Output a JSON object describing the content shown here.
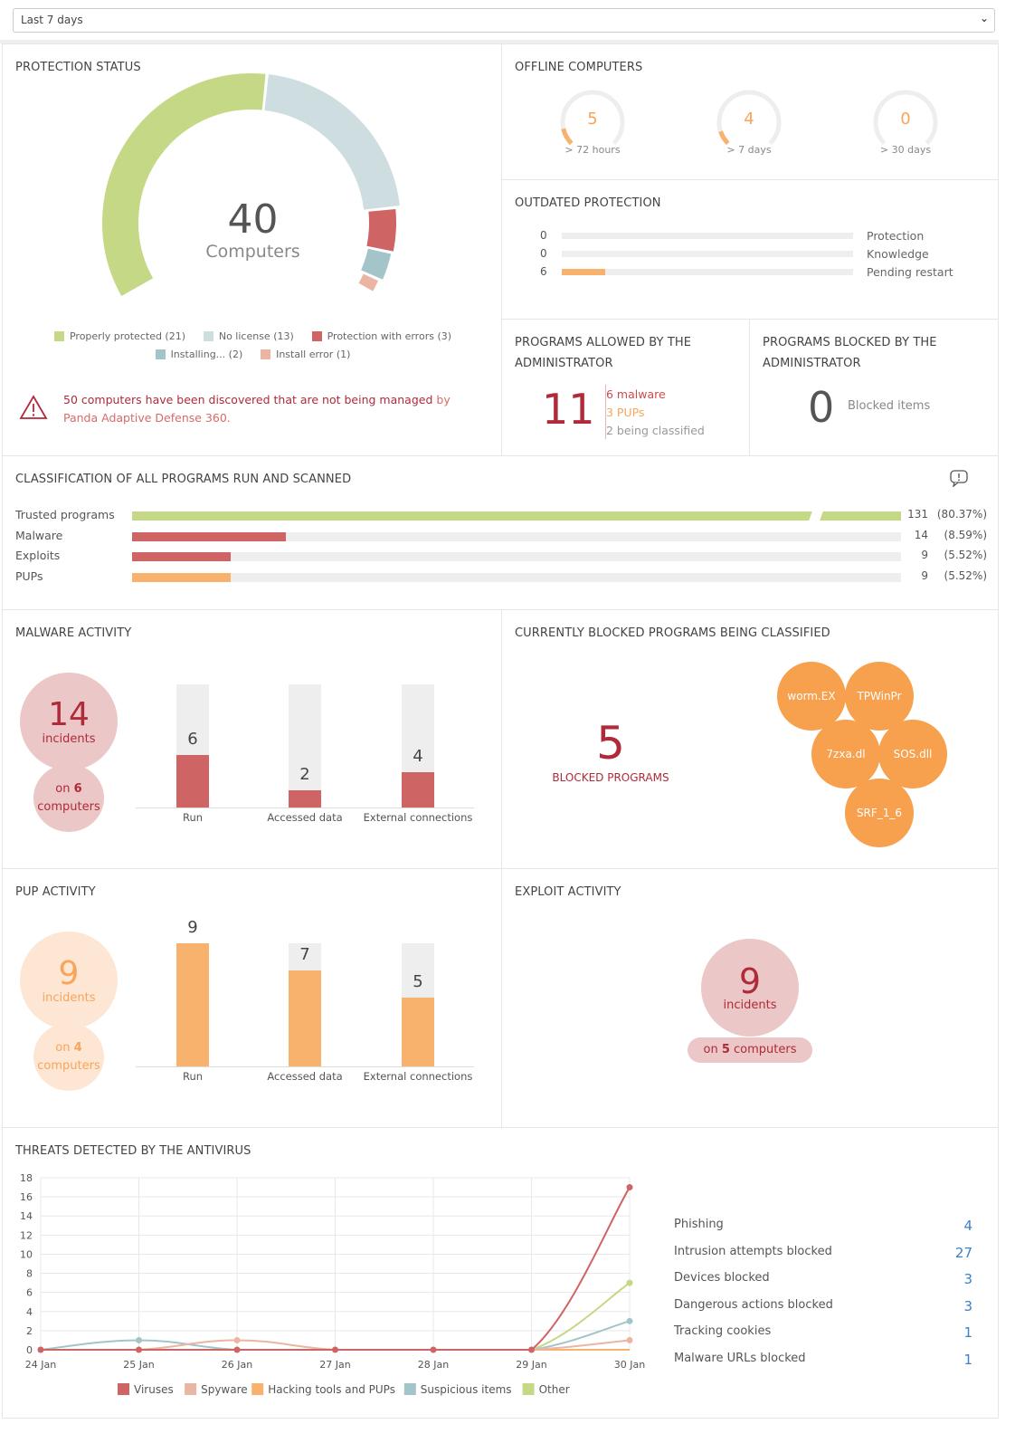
{
  "filter": {
    "selected": "Last 7 days"
  },
  "protection_status": {
    "title": "PROTECTION STATUS",
    "total": "40",
    "total_label": "Computers",
    "segments": [
      {
        "label": "Properly protected (21)",
        "value": 21,
        "color": "#c5d886"
      },
      {
        "label": "No license (13)",
        "value": 13,
        "color": "#cddde0"
      },
      {
        "label": "Protection with errors (3)",
        "value": 3,
        "color": "#cf6464"
      },
      {
        "label": "Installing... (2)",
        "value": 2,
        "color": "#a3c4c9"
      },
      {
        "label": "Install error (1)",
        "value": 1,
        "color": "#ebb5a3"
      }
    ],
    "alert_text": "50 computers have been discovered that are not being managed",
    "alert_by": "by",
    "alert_product": "Panda Adaptive Defense 360."
  },
  "offline": {
    "title": "OFFLINE COMPUTERS",
    "gauges": [
      {
        "value": "5",
        "label": "> 72 hours",
        "fraction": 0.12
      },
      {
        "value": "4",
        "label": "> 7 days",
        "fraction": 0.1
      },
      {
        "value": "0",
        "label": "> 30 days",
        "fraction": 0
      }
    ]
  },
  "outdated": {
    "title": "OUTDATED PROTECTION",
    "rows": [
      {
        "count": "0",
        "label": "Protection",
        "fraction": 0
      },
      {
        "count": "0",
        "label": "Knowledge",
        "fraction": 0
      },
      {
        "count": "6",
        "label": "Pending restart",
        "fraction": 0.15
      }
    ]
  },
  "allowed": {
    "title": "PROGRAMS ALLOWED BY THE ADMINISTRATOR",
    "count": "11",
    "malware": "6 malware",
    "pups": "3 PUPs",
    "classifying": "2 being classified"
  },
  "blocked": {
    "title": "PROGRAMS BLOCKED BY THE ADMINISTRATOR",
    "count": "0",
    "label": "Blocked items"
  },
  "classification": {
    "title": "CLASSIFICATION OF ALL PROGRAMS RUN AND SCANNED",
    "rows": [
      {
        "label": "Trusted programs",
        "count": "131",
        "pct": "(80.37%)",
        "fraction": 1,
        "color": "#c5d886"
      },
      {
        "label": "Malware",
        "count": "14",
        "pct": "(8.59%)",
        "fraction": 0.2,
        "color": "#cf6464"
      },
      {
        "label": "Exploits",
        "count": "9",
        "pct": "(5.52%)",
        "fraction": 0.128,
        "color": "#cf6464"
      },
      {
        "label": "PUPs",
        "count": "9",
        "pct": "(5.52%)",
        "fraction": 0.128,
        "color": "#f7b26e"
      }
    ]
  },
  "malware": {
    "title": "MALWARE ACTIVITY",
    "incidents": "14",
    "incidents_label": "incidents",
    "on": "on",
    "computers": "6",
    "computers_label": "computers",
    "bars": [
      {
        "label": "Run",
        "value": 6
      },
      {
        "label": "Accessed data",
        "value": 2
      },
      {
        "label": "External connections",
        "value": 4
      }
    ],
    "max": 14,
    "color": "#cf6464"
  },
  "blocked_classified": {
    "title": "CURRENTLY BLOCKED PROGRAMS BEING CLASSIFIED",
    "count": "5",
    "label": "BLOCKED PROGRAMS",
    "items": [
      "worm.EX",
      "TPWinPr",
      "7zxa.dl",
      "SOS.dll",
      "SRF_1_6"
    ]
  },
  "pup": {
    "title": "PUP ACTIVITY",
    "incidents": "9",
    "incidents_label": "incidents",
    "on": "on",
    "computers": "4",
    "computers_label": "computers",
    "bars": [
      {
        "label": "Run",
        "value": 9
      },
      {
        "label": "Accessed data",
        "value": 7
      },
      {
        "label": "External connections",
        "value": 5
      }
    ],
    "max": 9,
    "color": "#f7b26e"
  },
  "exploit": {
    "title": "EXPLOIT ACTIVITY",
    "incidents": "9",
    "incidents_label": "incidents",
    "on": "on",
    "computers": "5",
    "computers_label": "computers"
  },
  "threats": {
    "title": "THREATS DETECTED BY THE ANTIVIRUS",
    "stats": [
      {
        "label": "Phishing",
        "value": "4"
      },
      {
        "label": "Intrusion attempts blocked",
        "value": "27"
      },
      {
        "label": "Devices blocked",
        "value": "3"
      },
      {
        "label": "Dangerous actions blocked",
        "value": "3"
      },
      {
        "label": "Tracking cookies",
        "value": "1"
      },
      {
        "label": "Malware URLs blocked",
        "value": "1"
      }
    ]
  },
  "chart_data": {
    "type": "line",
    "x": [
      "24 Jan",
      "25 Jan",
      "26 Jan",
      "27 Jan",
      "28 Jan",
      "29 Jan",
      "30 Jan"
    ],
    "ylim": [
      0,
      18
    ],
    "yticks": [
      0,
      2,
      4,
      6,
      8,
      10,
      12,
      14,
      16,
      18
    ],
    "grid": true,
    "legend": "bottom",
    "series": [
      {
        "name": "Viruses",
        "color": "#cf6464",
        "values": [
          0,
          0,
          0,
          0,
          0,
          0,
          17
        ]
      },
      {
        "name": "Spyware",
        "color": "#ebb5a3",
        "values": [
          0,
          0,
          1,
          0,
          0,
          0,
          1
        ]
      },
      {
        "name": "Hacking tools and PUPs",
        "color": "#f7b26e",
        "values": [
          0,
          0,
          0,
          0,
          0,
          0,
          0
        ]
      },
      {
        "name": "Suspicious items",
        "color": "#a3c4c9",
        "values": [
          0,
          1,
          0,
          0,
          0,
          0,
          3
        ]
      },
      {
        "name": "Other",
        "color": "#c5d886",
        "values": [
          0,
          0,
          0,
          0,
          0,
          0,
          7
        ]
      }
    ]
  }
}
